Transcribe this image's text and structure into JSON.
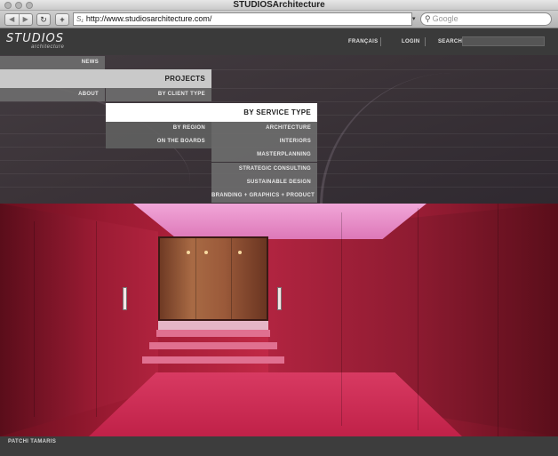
{
  "window": {
    "title": "STUDIOSArchitecture"
  },
  "browser": {
    "url": "http://www.studiosarchitecture.com/",
    "url_icon": "S₁",
    "search_placeholder": "Google",
    "back_glyph": "◀",
    "forward_glyph": "▶",
    "reload_glyph": "↻",
    "add_glyph": "+",
    "search_glyph": "⚲",
    "url_menu_glyph": "▾"
  },
  "site": {
    "logo": {
      "main": "STUDIOS",
      "sub": "architecture"
    },
    "header_nav": {
      "francais": "FRANÇAIS",
      "login": "LOGIN",
      "search": "SEARCH"
    },
    "menu": {
      "news": "NEWS",
      "projects": "PROJECTS",
      "about": "ABOUT",
      "by_client_type": "BY CLIENT TYPE",
      "by_service_type": "BY SERVICE TYPE",
      "by_region": "BY REGION",
      "on_the_boards": "ON THE BOARDS",
      "services": [
        "ARCHITECTURE",
        "INTERIORS",
        "MASTERPLANNING",
        "STRATEGIC CONSULTING",
        "SUSTAINABLE DESIGN",
        "BRANDING + GRAPHICS + PRODUCT"
      ]
    },
    "caption": "PATCHI TAMARIS"
  }
}
